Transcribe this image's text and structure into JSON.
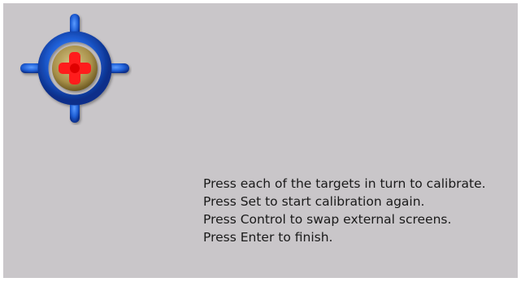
{
  "screen": {
    "background": "#c9c6c9"
  },
  "target": {
    "icon": "crosshair-target-icon",
    "ring_color": "#1f5fd6",
    "cross_color": "#ff1a1a",
    "center_color": "#b4a05a"
  },
  "instructions": [
    "Press each of the targets in turn to calibrate.",
    "Press Set to start calibration again.",
    "Press Control to swap external screens.",
    "Press Enter to finish."
  ]
}
